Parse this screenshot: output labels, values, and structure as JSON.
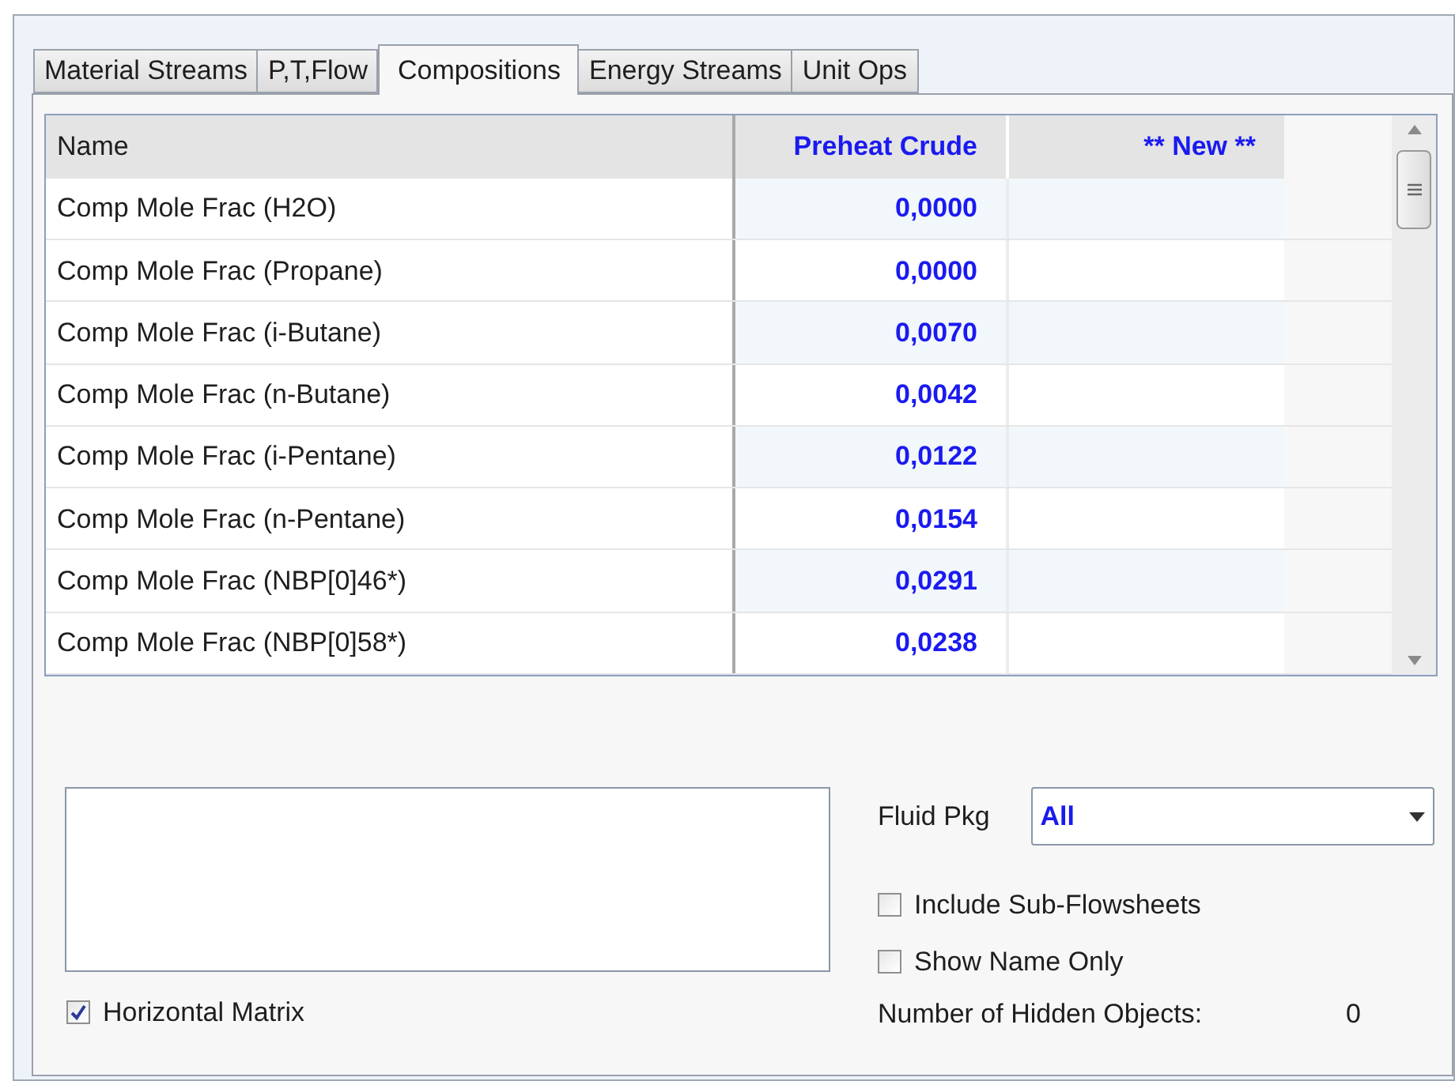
{
  "tabs": [
    {
      "label": "Material Streams",
      "selected": false
    },
    {
      "label": "P,T,Flow",
      "selected": false
    },
    {
      "label": "Compositions",
      "selected": true
    },
    {
      "label": "Energy Streams",
      "selected": false
    },
    {
      "label": "Unit Ops",
      "selected": false
    }
  ],
  "table": {
    "columns": [
      "Name",
      "Preheat Crude",
      "** New **"
    ],
    "rows": [
      {
        "name": "Comp Mole Frac (H2O)",
        "value": "0,0000"
      },
      {
        "name": "Comp Mole Frac (Propane)",
        "value": "0,0000"
      },
      {
        "name": "Comp Mole Frac (i-Butane)",
        "value": "0,0070"
      },
      {
        "name": "Comp Mole Frac (n-Butane)",
        "value": "0,0042"
      },
      {
        "name": "Comp Mole Frac (i-Pentane)",
        "value": "0,0122"
      },
      {
        "name": "Comp Mole Frac (n-Pentane)",
        "value": "0,0154"
      },
      {
        "name": "Comp Mole Frac (NBP[0]46*)",
        "value": "0,0291"
      },
      {
        "name": "Comp Mole Frac (NBP[0]58*)",
        "value": "0,0238"
      }
    ]
  },
  "horizontal_matrix": {
    "label": "Horizontal Matrix",
    "checked": true
  },
  "fluid_pkg": {
    "label": "Fluid Pkg",
    "value": "All"
  },
  "options": [
    {
      "label": "Include Sub-Flowsheets",
      "checked": false
    },
    {
      "label": "Show Name Only",
      "checked": false
    }
  ],
  "hidden_objects": {
    "label": "Number of Hidden Objects:",
    "value": "0"
  }
}
